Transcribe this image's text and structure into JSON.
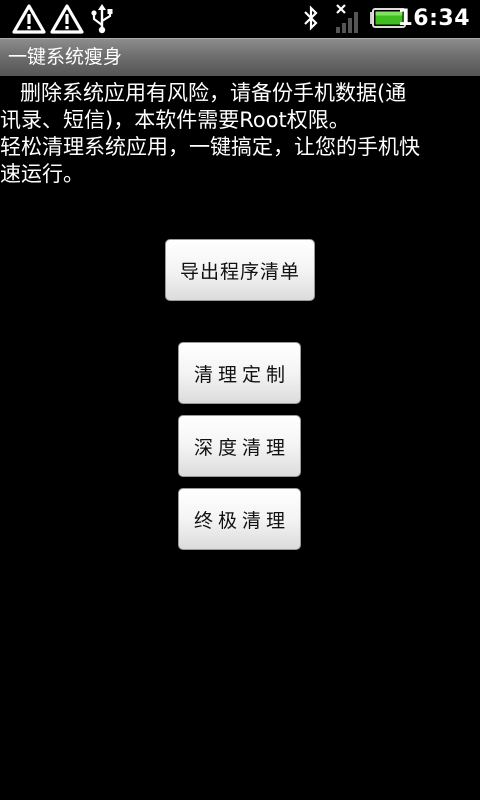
{
  "status_bar": {
    "time": "16:34",
    "icons": [
      "warning-icon",
      "warning-icon",
      "usb-icon",
      "bluetooth-icon",
      "no-signal-icon",
      "battery-icon"
    ]
  },
  "title_bar": {
    "title": "一键系统瘦身"
  },
  "description": {
    "line1": "删除系统应用有风险，请备份手机数据(通",
    "line2": "讯录、短信)，本软件需要Root权限。",
    "line3": "轻松清理系统应用，一键搞定，让您的手机快",
    "line4": "速运行。"
  },
  "buttons": {
    "export_list": "导出程序清单",
    "custom_clean": "清理定制",
    "deep_clean": "深度清理",
    "ultimate_clean": "终极清理"
  },
  "colors": {
    "background": "#000000",
    "title_bar": "#6f6f6f",
    "battery": "#3fbf1f",
    "button_bg": "#f4f4f4"
  }
}
